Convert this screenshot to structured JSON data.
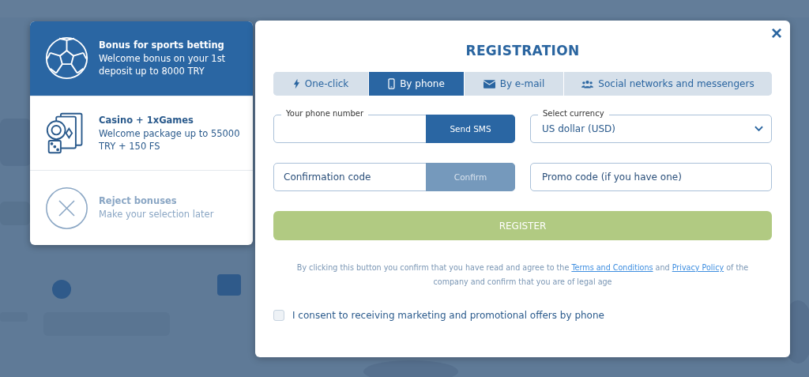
{
  "bonuses": [
    {
      "kind": "sports",
      "title": "Bonus for sports betting",
      "text": "Welcome bonus on your 1st deposit up to 8000 TRY",
      "selected": true
    },
    {
      "kind": "casino",
      "title": "Casino + 1xGames",
      "text": "Welcome package up to 55000 TRY + 150 FS",
      "selected": false
    },
    {
      "kind": "reject",
      "title": "Reject bonuses",
      "text": "Make your selection later",
      "selected": false
    }
  ],
  "modal": {
    "close": "×",
    "title": "REGISTRATION",
    "tabs": [
      {
        "kind": "bolt",
        "label": "One-click",
        "selected": false
      },
      {
        "kind": "phone",
        "label": "By phone",
        "selected": true
      },
      {
        "kind": "mail",
        "label": "By e-mail",
        "selected": false
      },
      {
        "kind": "people",
        "label": "Social networks and messengers",
        "selected": false
      }
    ],
    "phone": {
      "label": "Your phone number",
      "button": "Send SMS"
    },
    "currency": {
      "label": "Select currency",
      "value": "US dollar (USD)"
    },
    "confirmation": {
      "placeholder": "Confirmation code",
      "button": "Confirm",
      "disabled": true
    },
    "promo": {
      "placeholder": "Promo code (if you have one)"
    },
    "register": {
      "label": "REGISTER",
      "disabled": true
    },
    "terms": {
      "before": "By clicking this button you confirm that you have read and agree to the",
      "link1": "Terms and Conditions",
      "middle": "and",
      "link2": "Privacy Policy",
      "after": "of the company and confirm that you are of legal age"
    },
    "consent": {
      "label": "I consent to receiving marketing and promotional offers by phone",
      "checked": false
    }
  }
}
